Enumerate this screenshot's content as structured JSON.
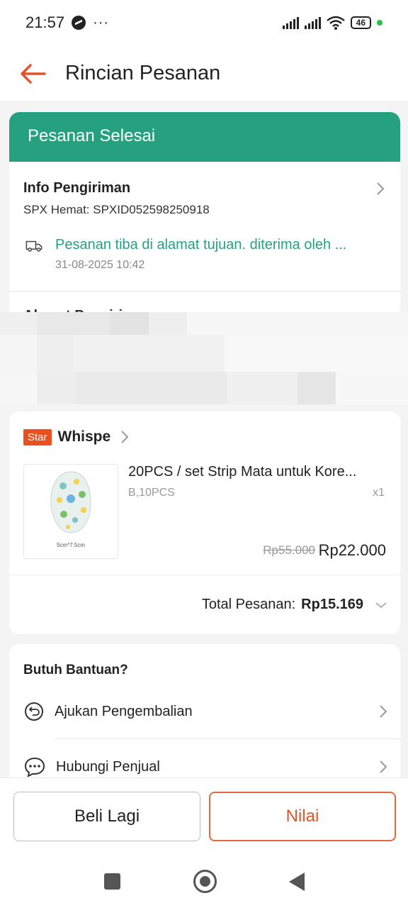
{
  "status_bar": {
    "time": "21:57",
    "dots": "···",
    "battery": "46"
  },
  "app_bar": {
    "title": "Rincian Pesanan"
  },
  "order_status": {
    "header": "Pesanan Selesai",
    "shipping_title": "Info Pengiriman",
    "shipping_sub": "SPX Hemat: SPXID052598250918",
    "tracking_text": "Pesanan tiba di alamat tujuan. diterima oleh ...",
    "tracking_time": "31-08-2025 10:42",
    "address_title_peek": "Alamat Pengiriman"
  },
  "product": {
    "badge": "Star",
    "shop_name": "Whispe",
    "name": "20PCS / set Strip Mata untuk Kore...",
    "variant": "B,10PCS",
    "quantity": "x1",
    "thumb_caption": "5cm*7.5cm",
    "price_original": "Rp55.000",
    "price_final": "Rp22.000",
    "total_label": "Total Pesanan:",
    "total_value": "Rp15.169"
  },
  "help": {
    "title": "Butuh Bantuan?",
    "items": [
      {
        "label": "Ajukan Pengembalian",
        "icon": "return-icon"
      },
      {
        "label": "Hubungi Penjual",
        "icon": "chat-icon"
      }
    ]
  },
  "actions": {
    "buy_again": "Beli Lagi",
    "rate": "Nilai"
  },
  "colors": {
    "primary_green": "#26a17f",
    "accent_orange": "#e4542a",
    "badge_red": "#ea501f"
  }
}
